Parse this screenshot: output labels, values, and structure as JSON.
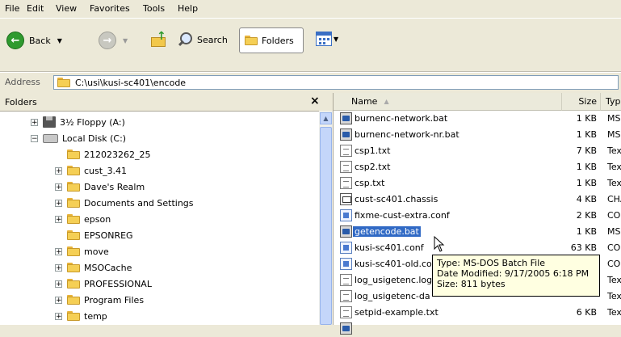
{
  "menu": [
    "File",
    "Edit",
    "View",
    "Favorites",
    "Tools",
    "Help"
  ],
  "toolbar": {
    "back": "Back",
    "search": "Search",
    "folders": "Folders"
  },
  "address": {
    "label": "Address",
    "path": "C:\\usi\\kusi-sc401\\encode"
  },
  "folders_pane": {
    "title": "Folders",
    "close": "×",
    "items": [
      {
        "label": "3½ Floppy (A:)",
        "indent": 1,
        "expander": "+",
        "icon": "floppy-icon"
      },
      {
        "label": "Local Disk (C:)",
        "indent": 1,
        "expander": "−",
        "icon": "disk-icon"
      },
      {
        "label": "212023262_25",
        "indent": 2,
        "expander": "",
        "icon": "folder-icon"
      },
      {
        "label": "cust_3.41",
        "indent": 2,
        "expander": "+",
        "icon": "folder-icon"
      },
      {
        "label": "Dave's Realm",
        "indent": 2,
        "expander": "+",
        "icon": "folder-icon"
      },
      {
        "label": "Documents and Settings",
        "indent": 2,
        "expander": "+",
        "icon": "folder-icon"
      },
      {
        "label": "epson",
        "indent": 2,
        "expander": "+",
        "icon": "folder-icon"
      },
      {
        "label": "EPSONREG",
        "indent": 2,
        "expander": "",
        "icon": "folder-icon"
      },
      {
        "label": "move",
        "indent": 2,
        "expander": "+",
        "icon": "folder-icon"
      },
      {
        "label": "MSOCache",
        "indent": 2,
        "expander": "+",
        "icon": "folder-icon"
      },
      {
        "label": "PROFESSIONAL",
        "indent": 2,
        "expander": "+",
        "icon": "folder-icon"
      },
      {
        "label": "Program Files",
        "indent": 2,
        "expander": "+",
        "icon": "folder-icon"
      },
      {
        "label": "temp",
        "indent": 2,
        "expander": "+",
        "icon": "folder-icon"
      }
    ]
  },
  "files": {
    "columns": {
      "name": "Name",
      "size": "Size",
      "type": "Typ"
    },
    "rows": [
      {
        "name": "burnenc-network.bat",
        "size": "1 KB",
        "type": "MS-",
        "icon": "bat"
      },
      {
        "name": "burnenc-network-nr.bat",
        "size": "1 KB",
        "type": "MS-",
        "icon": "bat"
      },
      {
        "name": "csp1.txt",
        "size": "7 KB",
        "type": "Tex",
        "icon": "txt"
      },
      {
        "name": "csp2.txt",
        "size": "1 KB",
        "type": "Tex",
        "icon": "txt"
      },
      {
        "name": "csp.txt",
        "size": "1 KB",
        "type": "Tex",
        "icon": "txt"
      },
      {
        "name": "cust-sc401.chassis",
        "size": "4 KB",
        "type": "CHA",
        "icon": "chassis"
      },
      {
        "name": "fixme-cust-extra.conf",
        "size": "2 KB",
        "type": "CON",
        "icon": "conf"
      },
      {
        "name": "getencode.bat",
        "size": "1 KB",
        "type": "MS-",
        "icon": "bat",
        "selected": true
      },
      {
        "name": "kusi-sc401.conf",
        "size": "63 KB",
        "type": "CON",
        "icon": "conf"
      },
      {
        "name": "kusi-sc401-old.co",
        "size": "",
        "type": "CON",
        "icon": "conf"
      },
      {
        "name": "log_usigetenc.log",
        "size": "",
        "type": "Tex",
        "icon": "txt"
      },
      {
        "name": "log_usigetenc-da",
        "size": "",
        "type": "Tex",
        "icon": "txt"
      },
      {
        "name": "setpid-example.txt",
        "size": "6 KB",
        "type": "Tex",
        "icon": "txt"
      }
    ]
  },
  "tooltip": {
    "type": "Type: MS-DOS Batch File",
    "modified": "Date Modified: 9/17/2005 6:18 PM",
    "size": "Size: 811 bytes"
  }
}
